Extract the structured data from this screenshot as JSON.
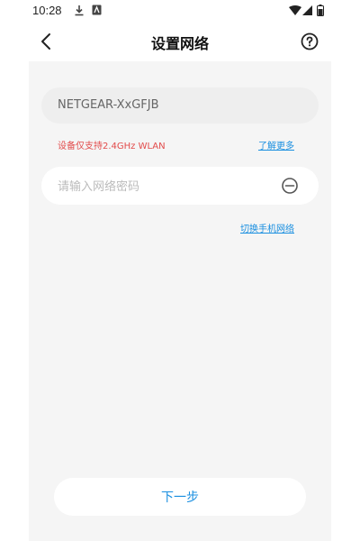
{
  "status_bar": {
    "time": "10:28",
    "icons": [
      "download-icon",
      "notification-icon",
      "wifi-icon",
      "signal-icon",
      "battery-icon"
    ]
  },
  "header": {
    "title": "设置网络",
    "back_icon": "back-arrow-icon",
    "help_icon": "help-circle-icon"
  },
  "form": {
    "ssid": "NETGEAR-XxGFJB",
    "notice": "设备仅支持2.4GHz WLAN",
    "learn_more": "了解更多",
    "password_placeholder": "请输入网络密码",
    "password_value": "",
    "toggle_icon": "eye-toggle-icon",
    "switch_network": "切换手机网络"
  },
  "footer": {
    "next_label": "下一步"
  },
  "colors": {
    "accent": "#1a8fe0",
    "warning": "#e24b4b",
    "background": "#f5f5f5"
  }
}
